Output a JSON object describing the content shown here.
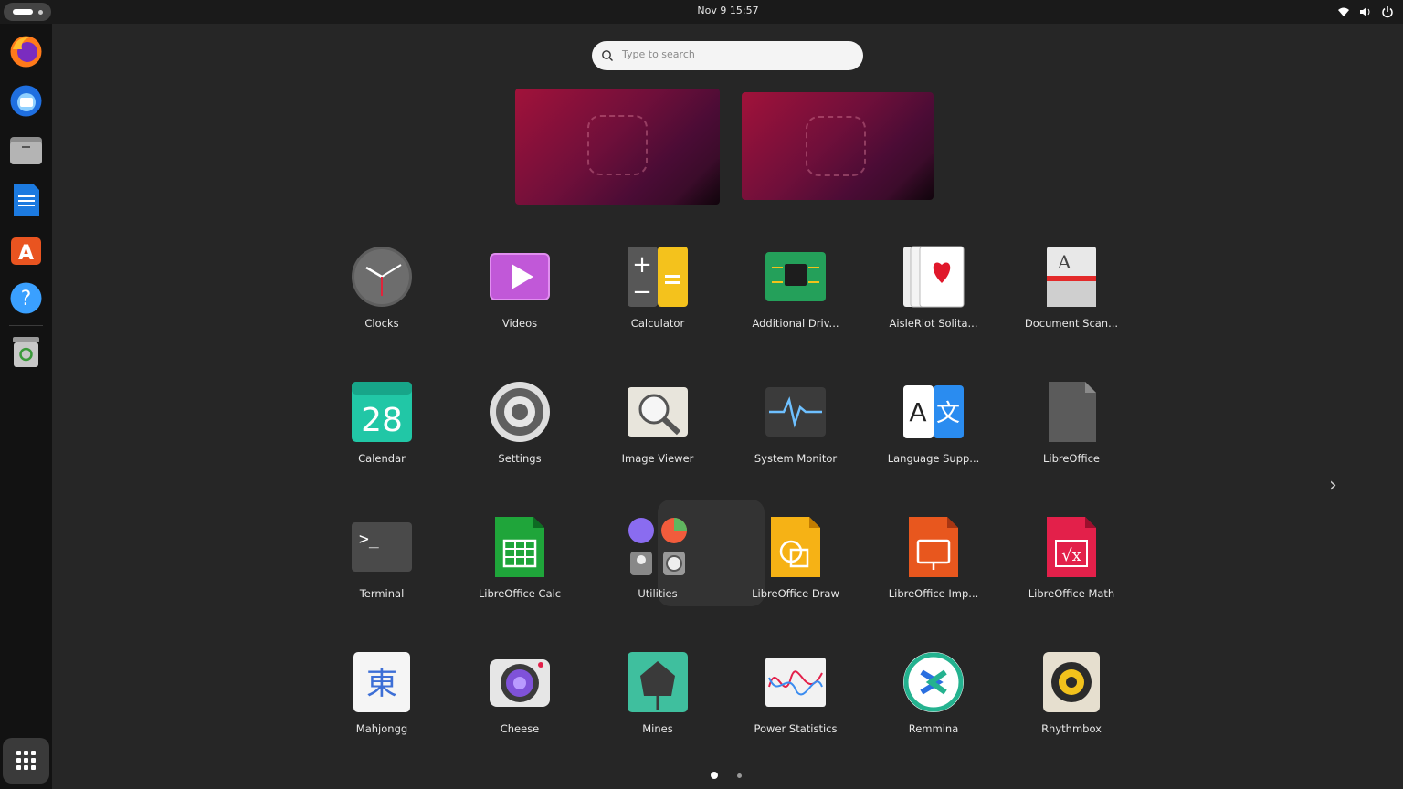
{
  "topbar": {
    "clock": "Nov 9  15:57",
    "tray_icons": [
      "wifi-icon",
      "volume-icon",
      "power-icon"
    ]
  },
  "dock": {
    "items": [
      {
        "name": "firefox",
        "icon": "firefox-icon"
      },
      {
        "name": "thunderbird",
        "icon": "thunderbird-icon"
      },
      {
        "name": "files",
        "icon": "files-icon"
      },
      {
        "name": "libreoffice-writer",
        "icon": "writer-icon"
      },
      {
        "name": "app-center",
        "icon": "app-center-icon"
      },
      {
        "name": "help",
        "icon": "help-icon"
      },
      {
        "name": "trash",
        "icon": "trash-icon"
      }
    ],
    "show_apps": "show-apps-icon"
  },
  "search": {
    "placeholder": "Type to search"
  },
  "apps": [
    {
      "label": "Clocks",
      "icon": "clock-icon"
    },
    {
      "label": "Videos",
      "icon": "videos-icon"
    },
    {
      "label": "Calculator",
      "icon": "calculator-icon"
    },
    {
      "label": "Additional Driv...",
      "icon": "chip-icon"
    },
    {
      "label": "AisleRiot Solita...",
      "icon": "cards-icon"
    },
    {
      "label": "Document Scan...",
      "icon": "scanner-icon"
    },
    {
      "label": "Calendar",
      "icon": "calendar-icon",
      "day": "28"
    },
    {
      "label": "Settings",
      "icon": "gear-icon"
    },
    {
      "label": "Image Viewer",
      "icon": "magnifier-icon"
    },
    {
      "label": "System Monitor",
      "icon": "monitor-icon"
    },
    {
      "label": "Language Supp...",
      "icon": "language-icon"
    },
    {
      "label": "LibreOffice",
      "icon": "libreoffice-icon"
    },
    {
      "label": "Terminal",
      "icon": "terminal-icon"
    },
    {
      "label": "LibreOffice Calc",
      "icon": "calc-icon"
    },
    {
      "label": "Utilities",
      "icon": "folder-icon"
    },
    {
      "label": "LibreOffice Draw",
      "icon": "draw-icon"
    },
    {
      "label": "LibreOffice Imp...",
      "icon": "impress-icon"
    },
    {
      "label": "LibreOffice Math",
      "icon": "math-icon"
    },
    {
      "label": "Mahjongg",
      "icon": "mahjongg-icon",
      "glyph": "東"
    },
    {
      "label": "Cheese",
      "icon": "camera-icon"
    },
    {
      "label": "Mines",
      "icon": "mine-icon"
    },
    {
      "label": "Power Statistics",
      "icon": "power-stats-icon"
    },
    {
      "label": "Remmina",
      "icon": "remmina-icon"
    },
    {
      "label": "Rhythmbox",
      "icon": "speaker-icon"
    }
  ],
  "pagination": {
    "pages": 2,
    "current": 1
  },
  "next_page": "chevron-right-icon",
  "colors": {
    "panel": "#1a1a1a",
    "dock": "#121212",
    "overview": "#262626",
    "accent": "#e95420"
  }
}
